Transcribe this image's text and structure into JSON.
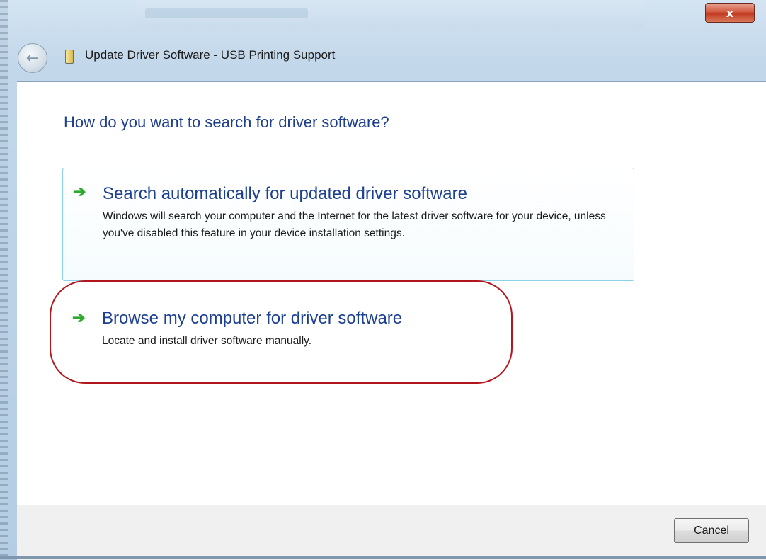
{
  "window": {
    "title": "Update Driver Software - USB Printing Support",
    "close_glyph": "x"
  },
  "main": {
    "heading": "How do you want to search for driver software?",
    "options": [
      {
        "arrow_glyph": "➔",
        "title": "Search automatically for updated driver software",
        "description": "Windows will search your computer and the Internet for the latest driver software for your device, unless you've disabled this feature in your device installation settings."
      },
      {
        "arrow_glyph": "➔",
        "title": "Browse my computer for driver software",
        "description": "Locate and install driver software manually."
      }
    ]
  },
  "footer": {
    "cancel_label": "Cancel"
  },
  "icons": {
    "back": "back-arrow-icon",
    "device": "usb-device-icon",
    "option_arrow": "green-arrow-icon",
    "close": "close-icon"
  },
  "colors": {
    "heading": "#1e3f8f",
    "arrow": "#2fa82f",
    "highlight_ring": "#b3151d",
    "option_border": "#8bd2e8"
  }
}
